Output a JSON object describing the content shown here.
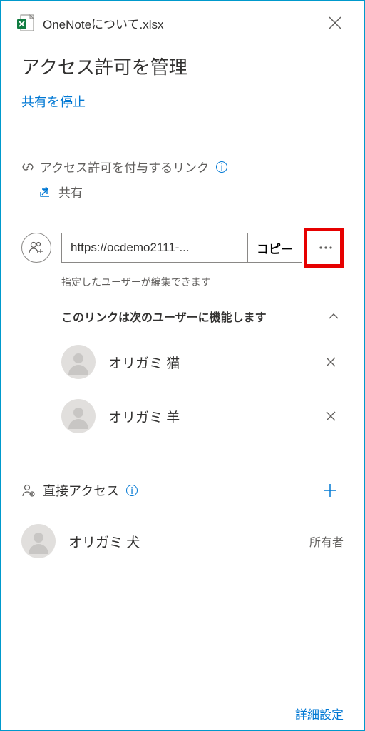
{
  "header": {
    "file_name": "OneNoteについて.xlsx"
  },
  "title": "アクセス許可を管理",
  "stop_share": "共有を停止",
  "links_section": {
    "header": "アクセス許可を付与するリンク",
    "share_label": "共有"
  },
  "link": {
    "url": "https://ocdemo2111-...",
    "copy_label": "コピー",
    "more_label": "…",
    "description": "指定したユーザーが編集できます",
    "works_for_label": "このリンクは次のユーザーに機能します",
    "users": [
      {
        "name": "オリガミ 猫"
      },
      {
        "name": "オリガミ 羊"
      }
    ]
  },
  "direct_access": {
    "label": "直接アクセス"
  },
  "owner": {
    "name": "オリガミ 犬",
    "role": "所有者"
  },
  "footer": {
    "advanced": "詳細設定"
  }
}
